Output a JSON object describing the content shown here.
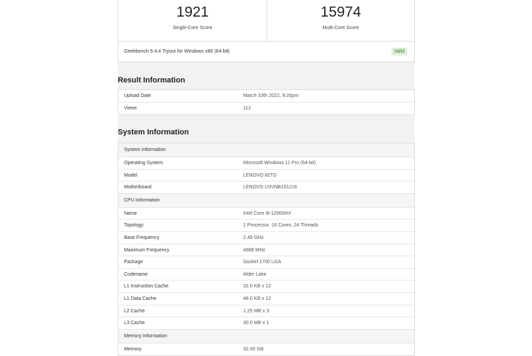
{
  "scores": {
    "single": {
      "value": "1921",
      "label": "Single-Core Score"
    },
    "multi": {
      "value": "15974",
      "label": "Multi-Core Score"
    },
    "version": "Geekbench 5.4.4 Tryout for Windows x86 (64-bit)",
    "badge": "Valid"
  },
  "result_info": {
    "heading": "Result Information",
    "rows": [
      {
        "name": "Upload Date",
        "value": "March 10th 2022, 9:26pm"
      },
      {
        "name": "Views",
        "value": "112"
      }
    ]
  },
  "system_info": {
    "heading": "System Information",
    "groups": [
      {
        "title": "System Information",
        "rows": [
          {
            "name": "Operating System",
            "value": "Microsoft Windows 11 Pro (64-bit)"
          },
          {
            "name": "Model",
            "value": "LENOVO 82TD"
          },
          {
            "name": "Motherboard",
            "value": "LENOVO LNVNB161216"
          }
        ]
      },
      {
        "title": "CPU Information",
        "rows": [
          {
            "name": "Name",
            "value": "Intel Core i9-12900HX"
          },
          {
            "name": "Topology",
            "value": "1 Processor, 16 Cores, 24 Threads"
          },
          {
            "name": "Base Frequency",
            "value": "2.49 GHz"
          },
          {
            "name": "Maximum Frequency",
            "value": "4888 MHz"
          },
          {
            "name": "Package",
            "value": "Socket 1700 LGA"
          },
          {
            "name": "Codename",
            "value": "Alder Lake"
          },
          {
            "name": "L1 Instruction Cache",
            "value": "32.0 KB x 12"
          },
          {
            "name": "L1 Data Cache",
            "value": "48.0 KB x 12"
          },
          {
            "name": "L2 Cache",
            "value": "1.25 MB x 3"
          },
          {
            "name": "L3 Cache",
            "value": "30.0 MB x 1"
          }
        ]
      },
      {
        "title": "Memory Information",
        "rows": [
          {
            "name": "Memory",
            "value": "32.00 GB"
          }
        ]
      }
    ]
  },
  "colors": {
    "valid_bg": "#dff0d8",
    "valid_text": "#3c763d",
    "group_bg": "#f5f5f5"
  }
}
